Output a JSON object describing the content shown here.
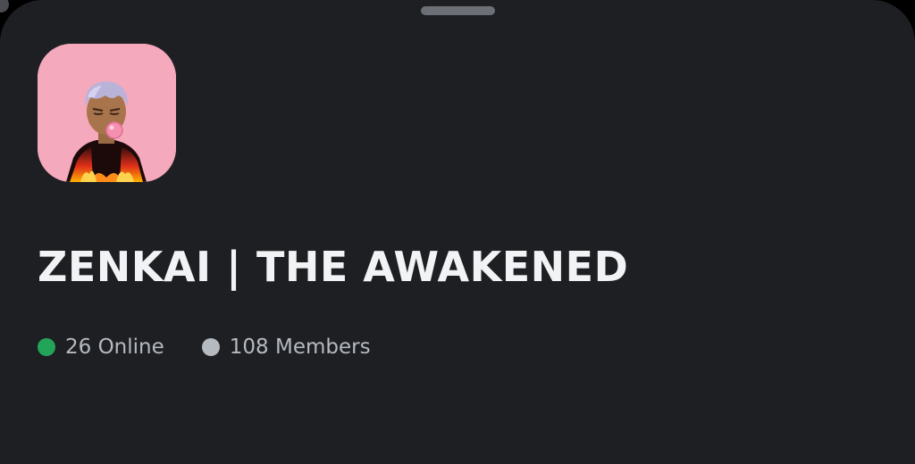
{
  "server": {
    "name": "ZENKAI | THE AWAKENED",
    "icon": "server-avatar-anime-character",
    "online_label": "26 Online",
    "members_label": "108 Members"
  },
  "colors": {
    "background": "#1e1f22",
    "title": "#f2f3f5",
    "stat_text": "#b5bac1",
    "online_dot": "#23a559",
    "members_dot": "#b5bac1",
    "icon_background": "#f4a9bc"
  }
}
